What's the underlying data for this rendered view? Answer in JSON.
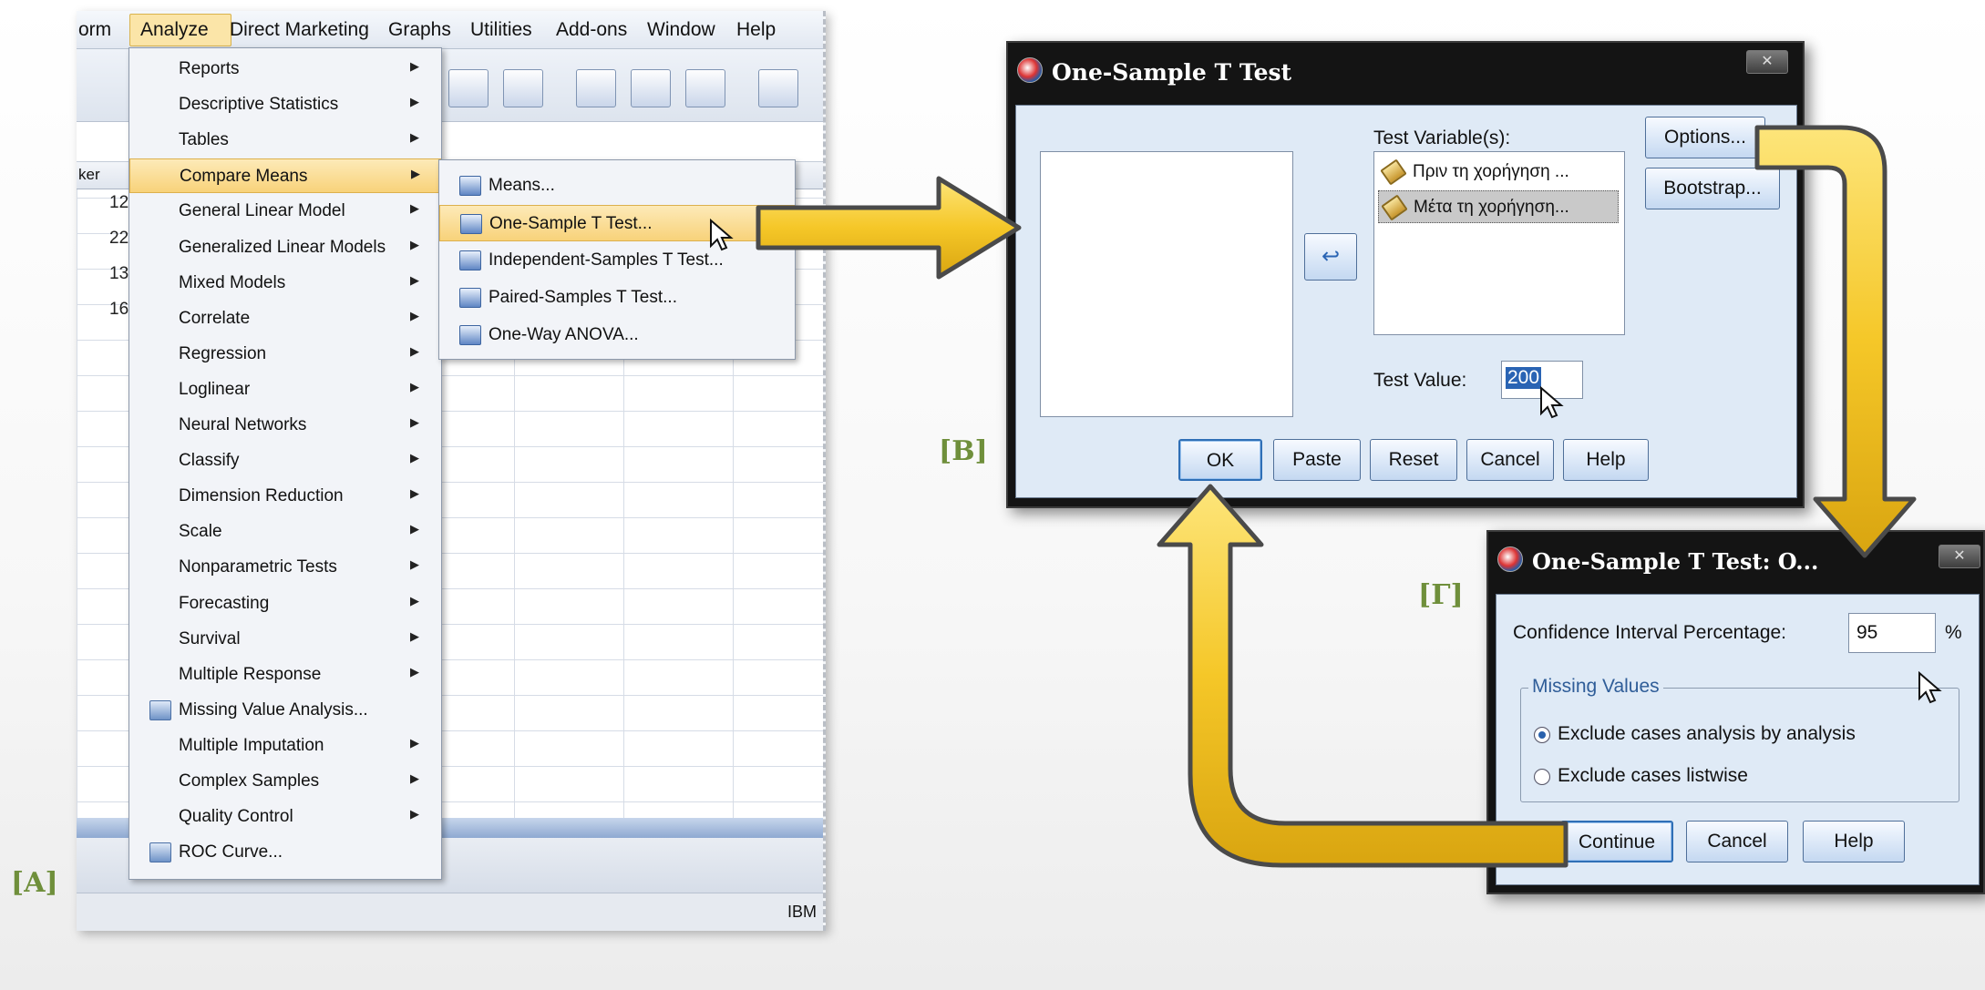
{
  "menubar": {
    "items": [
      "orm",
      "Analyze",
      "Direct Marketing",
      "Graphs",
      "Utilities",
      "Add-ons",
      "Window",
      "Help"
    ]
  },
  "grid": {
    "header_label": "ker",
    "rows": [
      "12",
      "22",
      "13",
      "16"
    ]
  },
  "analyze_menu": {
    "items": [
      {
        "label": "Reports",
        "submenu": true
      },
      {
        "label": "Descriptive Statistics",
        "submenu": true
      },
      {
        "label": "Tables",
        "submenu": true
      },
      {
        "label": "Compare Means",
        "submenu": true,
        "highlighted": true
      },
      {
        "label": "General Linear Model",
        "submenu": true
      },
      {
        "label": "Generalized Linear Models",
        "submenu": true
      },
      {
        "label": "Mixed Models",
        "submenu": true
      },
      {
        "label": "Correlate",
        "submenu": true
      },
      {
        "label": "Regression",
        "submenu": true
      },
      {
        "label": "Loglinear",
        "submenu": true
      },
      {
        "label": "Neural Networks",
        "submenu": true
      },
      {
        "label": "Classify",
        "submenu": true
      },
      {
        "label": "Dimension Reduction",
        "submenu": true
      },
      {
        "label": "Scale",
        "submenu": true
      },
      {
        "label": "Nonparametric Tests",
        "submenu": true
      },
      {
        "label": "Forecasting",
        "submenu": true
      },
      {
        "label": "Survival",
        "submenu": true
      },
      {
        "label": "Multiple Response",
        "submenu": true
      },
      {
        "label": "Missing Value Analysis...",
        "submenu": false,
        "icon": "missing-value-icon"
      },
      {
        "label": "Multiple Imputation",
        "submenu": true
      },
      {
        "label": "Complex Samples",
        "submenu": true
      },
      {
        "label": "Quality Control",
        "submenu": true
      },
      {
        "label": "ROC Curve...",
        "submenu": false,
        "icon": "roc-curve-icon"
      }
    ]
  },
  "compare_means_submenu": {
    "items": [
      {
        "label": "Means...",
        "icon": "means-icon"
      },
      {
        "label": "One-Sample T Test...",
        "icon": "one-sample-t-icon",
        "highlighted": true
      },
      {
        "label": "Independent-Samples T Test...",
        "icon": "independent-samples-icon"
      },
      {
        "label": "Paired-Samples T Test...",
        "icon": "paired-samples-icon"
      },
      {
        "label": "One-Way ANOVA...",
        "icon": "anova-icon"
      }
    ]
  },
  "status_bar": {
    "text": "IBM"
  },
  "labels": {
    "a": "[A]",
    "b": "[B]",
    "c": "[Γ]"
  },
  "dialog_b": {
    "title": "One-Sample T Test",
    "close": "✕",
    "test_variables_label": "Test Variable(s):",
    "test_variables": [
      "Πριν τη χορήγηση ...",
      "Μέτα τη χορήγηση..."
    ],
    "selected_variable_index": 1,
    "test_value_label": "Test Value:",
    "test_value": "200",
    "buttons": {
      "options": "Options...",
      "bootstrap": "Bootstrap...",
      "ok": "OK",
      "paste": "Paste",
      "reset": "Reset",
      "cancel": "Cancel",
      "help": "Help"
    }
  },
  "dialog_c": {
    "title": "One-Sample T Test: O...",
    "close": "✕",
    "ci_label": "Confidence Interval Percentage:",
    "ci_value": "95",
    "ci_unit": "%",
    "missing_values_legend": "Missing Values",
    "options": [
      {
        "label": "Exclude cases analysis by analysis",
        "selected": true
      },
      {
        "label": "Exclude cases listwise",
        "selected": false
      }
    ],
    "buttons": {
      "continue": "Continue",
      "cancel": "Cancel",
      "help": "Help"
    }
  },
  "colors": {
    "arrow_fill": "#f5c728",
    "panel_label": "#6f8f3b",
    "menu_highlight": "#f8d27a",
    "dialog_body": "#dfeaf6"
  }
}
